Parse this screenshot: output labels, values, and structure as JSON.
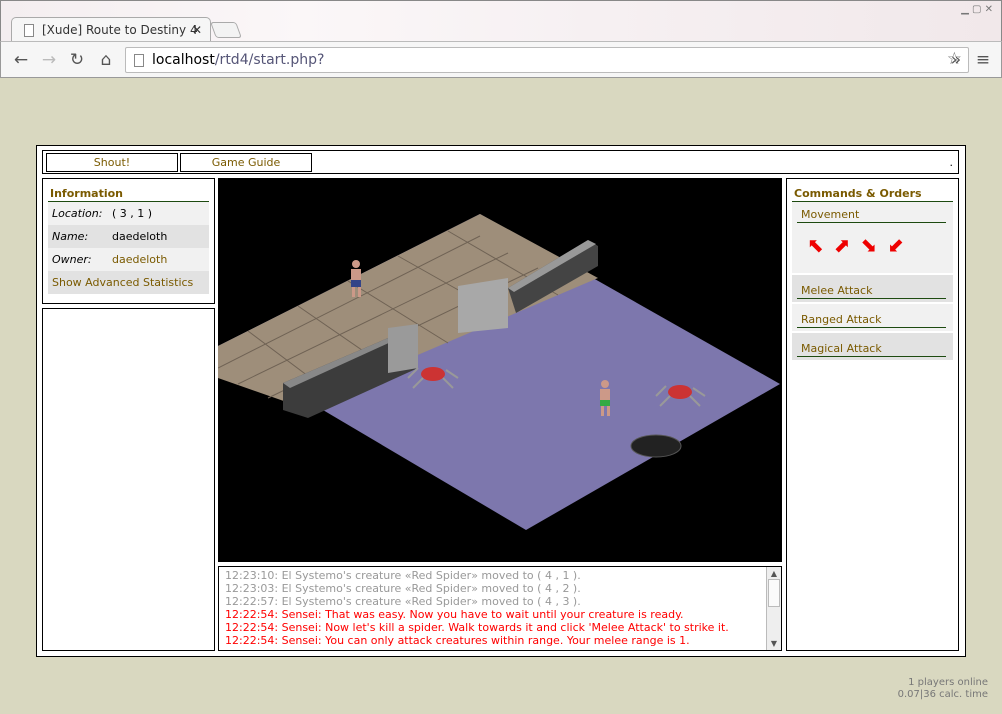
{
  "browser": {
    "tab_title": "[Xude] Route to Destiny 4",
    "url_host": "localhost",
    "url_path": "/rtd4/start.php?",
    "icons": [
      "back-icon",
      "forward-icon",
      "reload-icon",
      "home-icon",
      "star-icon",
      "menu-icon"
    ]
  },
  "topbar": {
    "shout": "Shout!",
    "guide": "Game Guide",
    "dot": "."
  },
  "info": {
    "title": "Information",
    "location_label": "Location:",
    "location_value": "( 3 , 1 )",
    "name_label": "Name:",
    "name_value": "daedeloth",
    "owner_label": "Owner:",
    "owner_value": "daedeloth",
    "advanced": "Show Advanced Statistics"
  },
  "commands": {
    "title": "Commands & Orders",
    "movement": "Movement",
    "melee": "Melee Attack",
    "ranged": "Ranged Attack",
    "magical": "Magical Attack"
  },
  "log": [
    {
      "text": "12:23:10: El Systemo's creature «Red Spider» moved to ( 4 , 1 ).",
      "type": "system"
    },
    {
      "text": "12:23:03: El Systemo's creature «Red Spider» moved to ( 4 , 2 ).",
      "type": "system"
    },
    {
      "text": "12:22:57: El Systemo's creature «Red Spider» moved to ( 4 , 3 ).",
      "type": "system"
    },
    {
      "text": "12:22:54: Sensei: That was easy. Now you have to wait until your creature is ready.",
      "type": "sensei"
    },
    {
      "text": "12:22:54: Sensei: Now let's kill a spider. Walk towards it and click 'Melee Attack' to strike it.",
      "type": "sensei"
    },
    {
      "text": "12:22:54: Sensei: You can only attack creatures within range. Your melee range is 1.",
      "type": "sensei"
    }
  ],
  "footer": {
    "players": "1 players online",
    "calc": "0.07|36 calc. time"
  },
  "colors": {
    "accent": "#7a5a00",
    "sensei": "#ff0000",
    "system": "#999999",
    "page_bg": "#d9d8c0"
  }
}
